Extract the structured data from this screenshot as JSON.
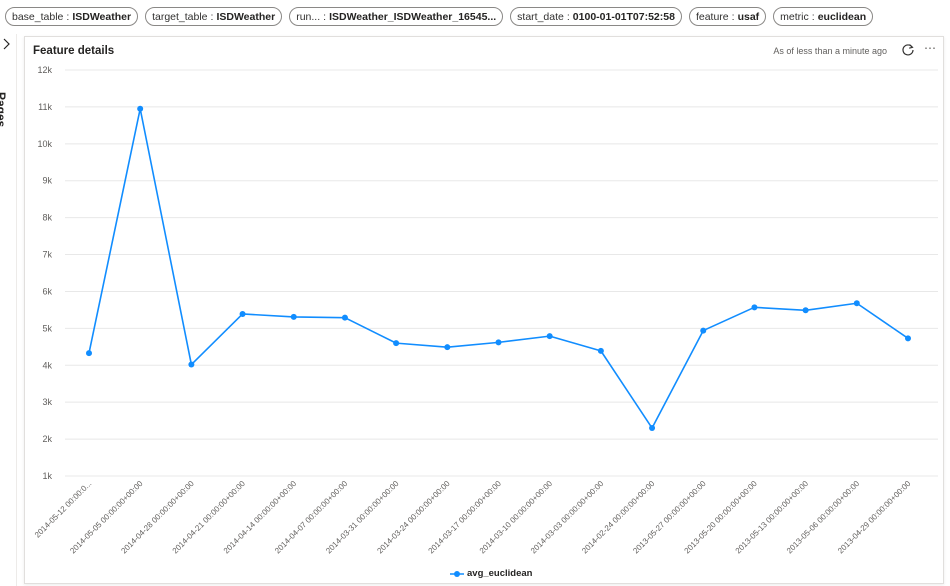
{
  "filters": [
    {
      "key": "base_table",
      "value": "ISDWeather"
    },
    {
      "key": "target_table",
      "value": "ISDWeather"
    },
    {
      "key": "run...",
      "value": "ISDWeather_ISDWeather_16545..."
    },
    {
      "key": "start_date",
      "value": "0100-01-01T07:52:58"
    },
    {
      "key": "feature",
      "value": "usaf"
    },
    {
      "key": "metric",
      "value": "euclidean"
    }
  ],
  "pages": {
    "label": "Pages"
  },
  "card": {
    "title": "Feature details",
    "status": "As of less than a minute ago",
    "more": "⋯"
  },
  "colors": {
    "series": "#118DFF",
    "grid": "#e8e8e8",
    "axis_text": "#605e5c"
  },
  "chart_data": {
    "type": "line",
    "x": [
      "2014-05-12 00:00:0...",
      "2014-05-05 00:00:00+00:00",
      "2014-04-28 00:00:00+00:00",
      "2014-04-21 00:00:00+00:00",
      "2014-04-14 00:00:00+00:00",
      "2014-04-07 00:00:00+00:00",
      "2014-03-31 00:00:00+00:00",
      "2014-03-24 00:00:00+00:00",
      "2014-03-17 00:00:00+00:00",
      "2014-03-10 00:00:00+00:00",
      "2014-03-03 00:00:00+00:00",
      "2014-02-24 00:00:00+00:00",
      "2013-05-27 00:00:00+00:00",
      "2013-05-20 00:00:00+00:00",
      "2013-05-13 00:00:00+00:00",
      "2013-05-06 00:00:00+00:00",
      "2013-04-29 00:00:00+00:00"
    ],
    "series": [
      {
        "name": "avg_euclidean",
        "values": [
          4330,
          10950,
          4020,
          5390,
          5310,
          5290,
          4600,
          4490,
          4620,
          4790,
          4390,
          2300,
          4940,
          5570,
          5490,
          5680,
          4730
        ]
      }
    ],
    "ylim": [
      1000,
      12000
    ],
    "yticks": [
      1000,
      2000,
      3000,
      4000,
      5000,
      6000,
      7000,
      8000,
      9000,
      10000,
      11000,
      12000
    ],
    "ytick_labels": [
      "1k",
      "2k",
      "3k",
      "4k",
      "5k",
      "6k",
      "7k",
      "8k",
      "9k",
      "10k",
      "11k",
      "12k"
    ],
    "grid": true,
    "legend_position": "bottom-center"
  }
}
